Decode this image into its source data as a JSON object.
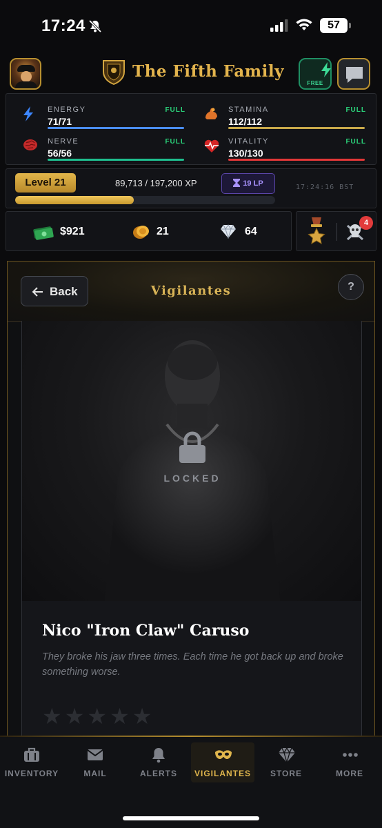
{
  "status_bar": {
    "time": "17:24",
    "battery": "57"
  },
  "header": {
    "title": "The Fifth Family",
    "free_label": "FREE"
  },
  "stats": [
    {
      "label": "ENERGY",
      "value": "71/71",
      "status": "FULL",
      "color": "#4a8dff",
      "icon": "lightning-icon"
    },
    {
      "label": "STAMINA",
      "value": "112/112",
      "status": "FULL",
      "color": "#c9a94a",
      "icon": "flexed-arm-icon"
    },
    {
      "label": "NERVE",
      "value": "56/56",
      "status": "FULL",
      "color": "#1fbf8f",
      "icon": "brain-icon"
    },
    {
      "label": "VITALITY",
      "value": "130/130",
      "status": "FULL",
      "color": "#e33838",
      "icon": "heartbeat-icon"
    }
  ],
  "level": {
    "label": "Level 21",
    "xp": "89,713 / 197,200 XP",
    "xp_progress": 0.455,
    "lp": "19 LP",
    "clock": "17:24:16 BST"
  },
  "currency": {
    "cash": "$921",
    "coins": "21",
    "diamonds": "64",
    "notifications": "4"
  },
  "page": {
    "back_label": "Back",
    "title": "Vigilantes",
    "help": "?"
  },
  "character": {
    "locked_label": "LOCKED",
    "name": "Nico \"Iron Claw\" Caruso",
    "quote": "They broke his jaw three times. Each time he got back up and broke something worse.",
    "stars": "★★★★★",
    "rating": 0
  },
  "nav": [
    {
      "label": "INVENTORY",
      "icon": "briefcase-icon"
    },
    {
      "label": "MAIL",
      "icon": "mail-icon"
    },
    {
      "label": "ALERTS",
      "icon": "bell-icon"
    },
    {
      "label": "VIGILANTES",
      "icon": "mask-icon",
      "active": true
    },
    {
      "label": "STORE",
      "icon": "diamond-icon"
    },
    {
      "label": "MORE",
      "icon": "dots-icon"
    }
  ]
}
